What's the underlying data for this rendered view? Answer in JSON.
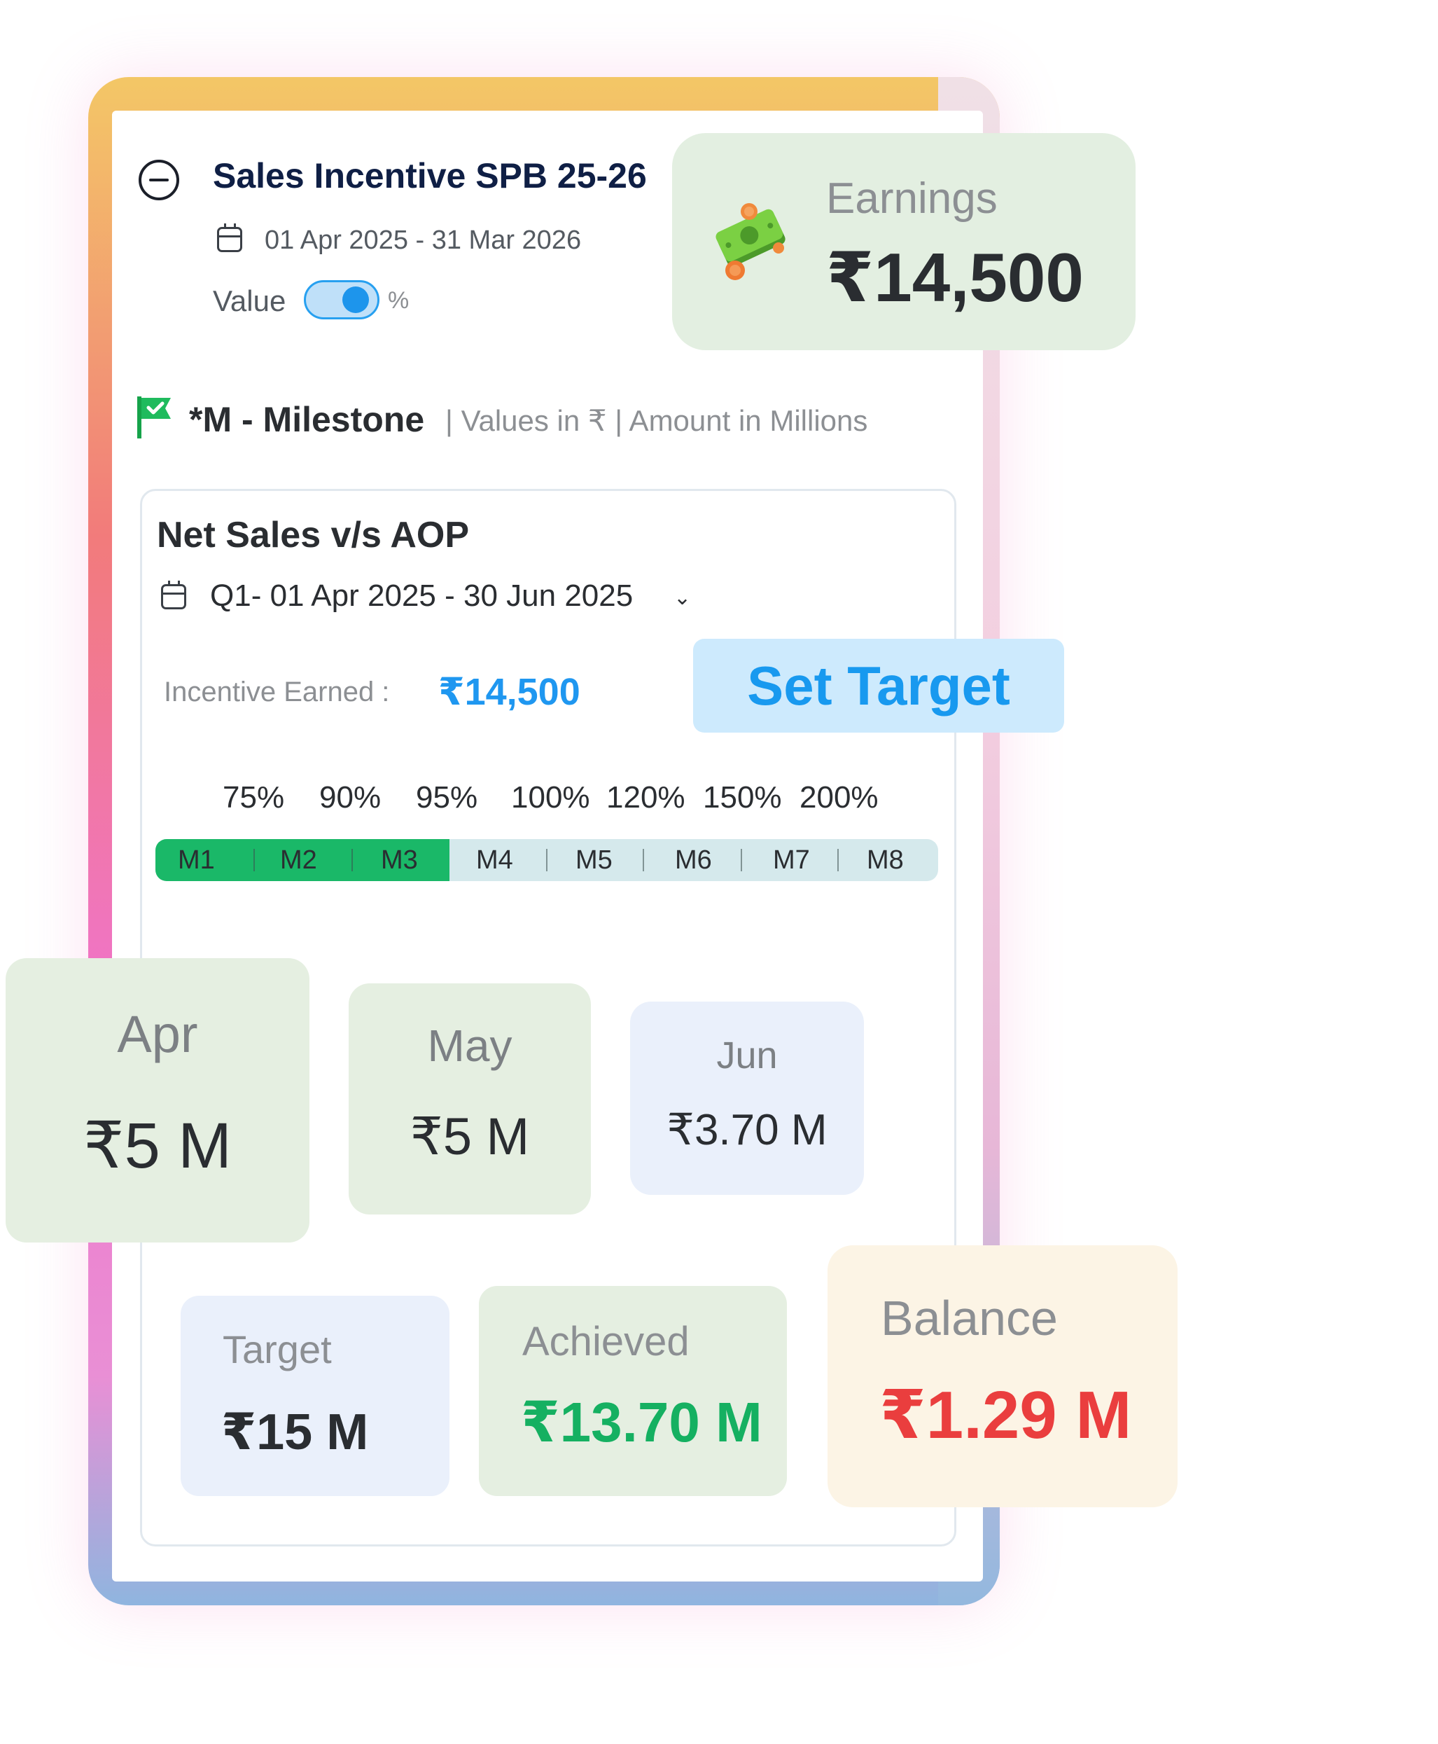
{
  "header": {
    "title": "Sales Incentive SPB 25-26",
    "date_range": "01 Apr 2025 - 31 Mar 2026",
    "toggle_left_label": "Value",
    "toggle_right_label": "%"
  },
  "legend": {
    "milestone": "*M - Milestone",
    "rest": "|  Values in ₹  |  Amount in Millions"
  },
  "card": {
    "title": "Net Sales v/s AOP",
    "quarter": "Q1- 01 Apr 2025 - 30 Jun 2025",
    "incentive_label": "Incentive Earned :",
    "incentive_value": "₹14,500",
    "set_target_label": "Set Target",
    "percentages": [
      "75%",
      "90%",
      "95%",
      "100%",
      "120%",
      "150%",
      "200%"
    ],
    "milestones": [
      "M1",
      "M2",
      "M3",
      "M4",
      "M5",
      "M6",
      "M7",
      "M8"
    ],
    "milestones_achieved": 3,
    "accent_green": "#1ab868",
    "accent_blue": "#1f97f0"
  },
  "months": [
    {
      "name": "Apr",
      "value": "₹5 M"
    },
    {
      "name": "May",
      "value": "₹5 M"
    },
    {
      "name": "Jun",
      "value": "₹3.70 M"
    }
  ],
  "summary": {
    "target_label": "Target",
    "target_value": "₹15 M",
    "achieved_label": "Achieved",
    "achieved_value": "₹13.70 M",
    "balance_label": "Balance",
    "balance_value": "₹1.29 M",
    "achieved_color": "#15b061",
    "balance_color": "#ea3e3e"
  },
  "earnings": {
    "label": "Earnings",
    "value": "₹14,500",
    "icon": "money-stack-icon"
  }
}
